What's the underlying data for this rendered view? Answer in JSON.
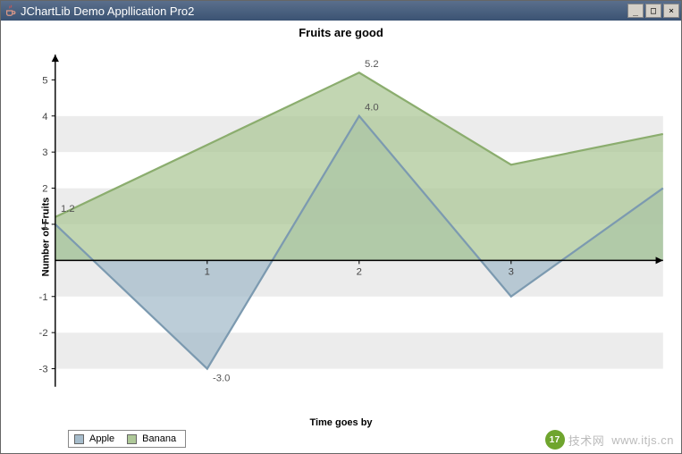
{
  "window": {
    "title": "JChartLib Demo Appllication Pro2",
    "min": "_",
    "max": "□",
    "close": "×"
  },
  "chart_data": {
    "type": "area",
    "title": "Fruits are good",
    "xlabel": "Time goes by",
    "ylabel": "Number of Fruits",
    "x": [
      0,
      1,
      2,
      3,
      4
    ],
    "x_tick_labels": [
      "",
      "1",
      "2",
      "3",
      ""
    ],
    "y_ticks": [
      -3,
      -2,
      -1,
      0,
      1,
      2,
      3,
      4,
      5
    ],
    "ylim": [
      -3.5,
      5.7
    ],
    "series": [
      {
        "name": "Apple",
        "color_line": "#7c9ab0",
        "color_fill": "#a6bccb",
        "values": [
          1,
          -3,
          4,
          -1,
          2
        ]
      },
      {
        "name": "Banana",
        "color_line": "#8bad6e",
        "color_fill": "#aec898",
        "values": [
          1.2,
          3.2,
          5.2,
          2.65,
          3.5
        ]
      }
    ],
    "annotations": [
      {
        "x": 0,
        "y": 1.2,
        "text": "1.2"
      },
      {
        "x": 1,
        "y": -3,
        "text": "-3.0"
      },
      {
        "x": 2,
        "y": 5.2,
        "text": "5.2"
      },
      {
        "x": 2,
        "y": 4,
        "text": "4.0"
      }
    ]
  },
  "legend": {
    "items": [
      {
        "label": "Apple"
      },
      {
        "label": "Banana"
      }
    ]
  },
  "watermark": {
    "badge": "17",
    "suffix": "技术网",
    "url": "www.itjs.cn"
  }
}
